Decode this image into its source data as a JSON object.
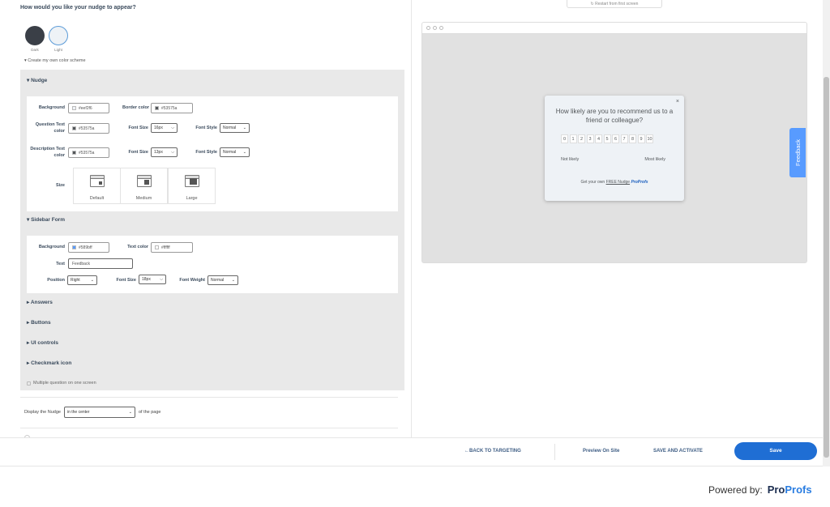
{
  "question": "How would you like your nudge to appear?",
  "themes": [
    "Dark",
    "Light"
  ],
  "create_scheme": "Create my own color scheme",
  "nudge_section": {
    "title": "Nudge",
    "background_label": "Background",
    "background_value": "#eef2f6",
    "border_label": "Border color",
    "border_value": "#53575a",
    "qtext_label": "Question Text color",
    "qtext_value": "#53575a",
    "font_size_label": "Font Size",
    "qtext_font_size": "16px",
    "font_style_label": "Font Style",
    "qtext_font_style": "Normal",
    "desc_label": "Description Text color",
    "desc_value": "#53575a",
    "desc_font_size": "13px",
    "desc_font_style": "Normal",
    "size_label": "Size",
    "sizes": [
      "Default",
      "Medium",
      "Large"
    ]
  },
  "sidebar_section": {
    "title": "Sidebar Form",
    "background_label": "Background",
    "background_value": "#589bff",
    "text_color_label": "Text color",
    "text_color_value": "#ffffff",
    "text_label": "Text",
    "text_value": "Feedback",
    "position_label": "Position",
    "position_value": "Right",
    "font_size_label": "Font Size",
    "font_size_value": "18px",
    "font_weight_label": "Font Weight",
    "font_weight_value": "Normal"
  },
  "collapsed_sections": [
    "Answers",
    "Buttons",
    "UI controls",
    "Checkmark icon"
  ],
  "multiple_question": "Multiple question on one screen",
  "display": {
    "prefix": "Display the Nudge",
    "value": "in the center",
    "suffix": "of the page"
  },
  "preview": {
    "restart": "Restart from first screen",
    "question": "How likely are you to recommend us to a friend or colleague?",
    "scale": [
      "0",
      "1",
      "2",
      "3",
      "4",
      "5",
      "6",
      "7",
      "8",
      "9",
      "10"
    ],
    "low": "Not likely",
    "high": "Most likely",
    "own_prefix": "Get your own",
    "own_link": "FREE Nudge",
    "own_brand": "ProProfs",
    "feedback_tab": "Feedback"
  },
  "footer": {
    "back": "←BACK TO TARGETING",
    "preview": "Preview On Site",
    "save_activate": "SAVE AND ACTIVATE",
    "save": "Save"
  },
  "powered": {
    "label": "Powered by:",
    "logo_a": "Pro",
    "logo_b": "Profs"
  },
  "colors": {
    "accent": "#1f6ed4",
    "sidebar_bg": "#589bff",
    "nudge_bg": "#eef2f6",
    "nudge_text": "#53575a"
  }
}
